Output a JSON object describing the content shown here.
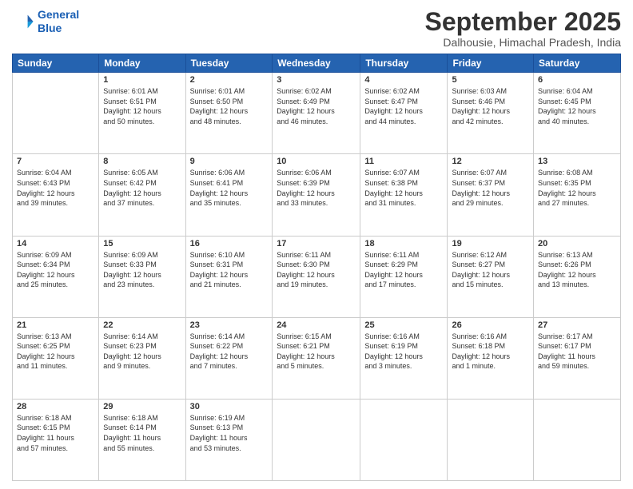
{
  "header": {
    "logo_line1": "General",
    "logo_line2": "Blue",
    "month_year": "September 2025",
    "location": "Dalhousie, Himachal Pradesh, India"
  },
  "days_of_week": [
    "Sunday",
    "Monday",
    "Tuesday",
    "Wednesday",
    "Thursday",
    "Friday",
    "Saturday"
  ],
  "weeks": [
    [
      {
        "day": "",
        "info": ""
      },
      {
        "day": "1",
        "info": "Sunrise: 6:01 AM\nSunset: 6:51 PM\nDaylight: 12 hours\nand 50 minutes."
      },
      {
        "day": "2",
        "info": "Sunrise: 6:01 AM\nSunset: 6:50 PM\nDaylight: 12 hours\nand 48 minutes."
      },
      {
        "day": "3",
        "info": "Sunrise: 6:02 AM\nSunset: 6:49 PM\nDaylight: 12 hours\nand 46 minutes."
      },
      {
        "day": "4",
        "info": "Sunrise: 6:02 AM\nSunset: 6:47 PM\nDaylight: 12 hours\nand 44 minutes."
      },
      {
        "day": "5",
        "info": "Sunrise: 6:03 AM\nSunset: 6:46 PM\nDaylight: 12 hours\nand 42 minutes."
      },
      {
        "day": "6",
        "info": "Sunrise: 6:04 AM\nSunset: 6:45 PM\nDaylight: 12 hours\nand 40 minutes."
      }
    ],
    [
      {
        "day": "7",
        "info": "Sunrise: 6:04 AM\nSunset: 6:43 PM\nDaylight: 12 hours\nand 39 minutes."
      },
      {
        "day": "8",
        "info": "Sunrise: 6:05 AM\nSunset: 6:42 PM\nDaylight: 12 hours\nand 37 minutes."
      },
      {
        "day": "9",
        "info": "Sunrise: 6:06 AM\nSunset: 6:41 PM\nDaylight: 12 hours\nand 35 minutes."
      },
      {
        "day": "10",
        "info": "Sunrise: 6:06 AM\nSunset: 6:39 PM\nDaylight: 12 hours\nand 33 minutes."
      },
      {
        "day": "11",
        "info": "Sunrise: 6:07 AM\nSunset: 6:38 PM\nDaylight: 12 hours\nand 31 minutes."
      },
      {
        "day": "12",
        "info": "Sunrise: 6:07 AM\nSunset: 6:37 PM\nDaylight: 12 hours\nand 29 minutes."
      },
      {
        "day": "13",
        "info": "Sunrise: 6:08 AM\nSunset: 6:35 PM\nDaylight: 12 hours\nand 27 minutes."
      }
    ],
    [
      {
        "day": "14",
        "info": "Sunrise: 6:09 AM\nSunset: 6:34 PM\nDaylight: 12 hours\nand 25 minutes."
      },
      {
        "day": "15",
        "info": "Sunrise: 6:09 AM\nSunset: 6:33 PM\nDaylight: 12 hours\nand 23 minutes."
      },
      {
        "day": "16",
        "info": "Sunrise: 6:10 AM\nSunset: 6:31 PM\nDaylight: 12 hours\nand 21 minutes."
      },
      {
        "day": "17",
        "info": "Sunrise: 6:11 AM\nSunset: 6:30 PM\nDaylight: 12 hours\nand 19 minutes."
      },
      {
        "day": "18",
        "info": "Sunrise: 6:11 AM\nSunset: 6:29 PM\nDaylight: 12 hours\nand 17 minutes."
      },
      {
        "day": "19",
        "info": "Sunrise: 6:12 AM\nSunset: 6:27 PM\nDaylight: 12 hours\nand 15 minutes."
      },
      {
        "day": "20",
        "info": "Sunrise: 6:13 AM\nSunset: 6:26 PM\nDaylight: 12 hours\nand 13 minutes."
      }
    ],
    [
      {
        "day": "21",
        "info": "Sunrise: 6:13 AM\nSunset: 6:25 PM\nDaylight: 12 hours\nand 11 minutes."
      },
      {
        "day": "22",
        "info": "Sunrise: 6:14 AM\nSunset: 6:23 PM\nDaylight: 12 hours\nand 9 minutes."
      },
      {
        "day": "23",
        "info": "Sunrise: 6:14 AM\nSunset: 6:22 PM\nDaylight: 12 hours\nand 7 minutes."
      },
      {
        "day": "24",
        "info": "Sunrise: 6:15 AM\nSunset: 6:21 PM\nDaylight: 12 hours\nand 5 minutes."
      },
      {
        "day": "25",
        "info": "Sunrise: 6:16 AM\nSunset: 6:19 PM\nDaylight: 12 hours\nand 3 minutes."
      },
      {
        "day": "26",
        "info": "Sunrise: 6:16 AM\nSunset: 6:18 PM\nDaylight: 12 hours\nand 1 minute."
      },
      {
        "day": "27",
        "info": "Sunrise: 6:17 AM\nSunset: 6:17 PM\nDaylight: 11 hours\nand 59 minutes."
      }
    ],
    [
      {
        "day": "28",
        "info": "Sunrise: 6:18 AM\nSunset: 6:15 PM\nDaylight: 11 hours\nand 57 minutes."
      },
      {
        "day": "29",
        "info": "Sunrise: 6:18 AM\nSunset: 6:14 PM\nDaylight: 11 hours\nand 55 minutes."
      },
      {
        "day": "30",
        "info": "Sunrise: 6:19 AM\nSunset: 6:13 PM\nDaylight: 11 hours\nand 53 minutes."
      },
      {
        "day": "",
        "info": ""
      },
      {
        "day": "",
        "info": ""
      },
      {
        "day": "",
        "info": ""
      },
      {
        "day": "",
        "info": ""
      }
    ]
  ]
}
